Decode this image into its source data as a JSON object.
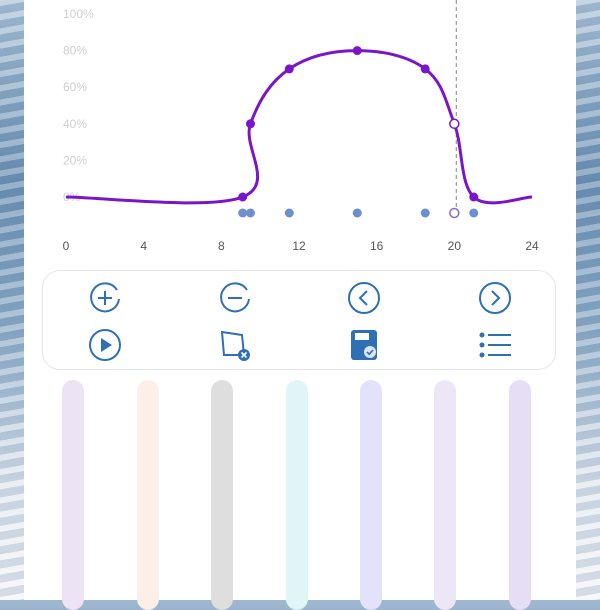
{
  "chart_data": {
    "type": "line",
    "x_ticks": [
      "0",
      "4",
      "8",
      "12",
      "16",
      "20",
      "24"
    ],
    "y_ticks": [
      "100%",
      "80%",
      "60%",
      "40%",
      "20%",
      "0%"
    ],
    "xlim": [
      0,
      24
    ],
    "ylim": [
      0,
      100
    ],
    "grid": false,
    "series": [
      {
        "color": "#7a16c9",
        "points": [
          [
            0,
            0
          ],
          [
            9.1,
            0
          ],
          [
            9.5,
            40
          ],
          [
            11.5,
            70
          ],
          [
            15,
            80
          ],
          [
            18.5,
            70
          ],
          [
            20,
            40
          ],
          [
            21,
            0
          ],
          [
            24,
            0
          ]
        ]
      }
    ],
    "marker_x": [
      9.1,
      9.5,
      11.5,
      15,
      18.5,
      20,
      21
    ],
    "selected_marker_index": 5,
    "current_time_x": 20.1
  },
  "controls": {
    "row1": [
      {
        "name": "add-point-button",
        "icon": "plus-circle-icon"
      },
      {
        "name": "remove-point-button",
        "icon": "minus-circle-icon"
      },
      {
        "name": "previous-point-button",
        "icon": "chevron-left-circle-icon"
      },
      {
        "name": "next-point-button",
        "icon": "chevron-right-circle-icon"
      }
    ],
    "row2": [
      {
        "name": "play-button",
        "icon": "play-circle-icon"
      },
      {
        "name": "clear-button",
        "icon": "clear-card-icon"
      },
      {
        "name": "save-button",
        "icon": "save-check-icon"
      },
      {
        "name": "list-button",
        "icon": "list-icon"
      }
    ],
    "accent": "#2f6fb3"
  },
  "channels": [
    {
      "name": "channel-1",
      "color": "#ece3f4"
    },
    {
      "name": "channel-2",
      "color": "#fbefe8"
    },
    {
      "name": "channel-3",
      "color": "#dedede"
    },
    {
      "name": "channel-4",
      "color": "#dff5f6"
    },
    {
      "name": "channel-5",
      "color": "#e2e2fb"
    },
    {
      "name": "channel-6",
      "color": "#ece6f6"
    },
    {
      "name": "channel-7",
      "color": "#e6def5"
    }
  ]
}
